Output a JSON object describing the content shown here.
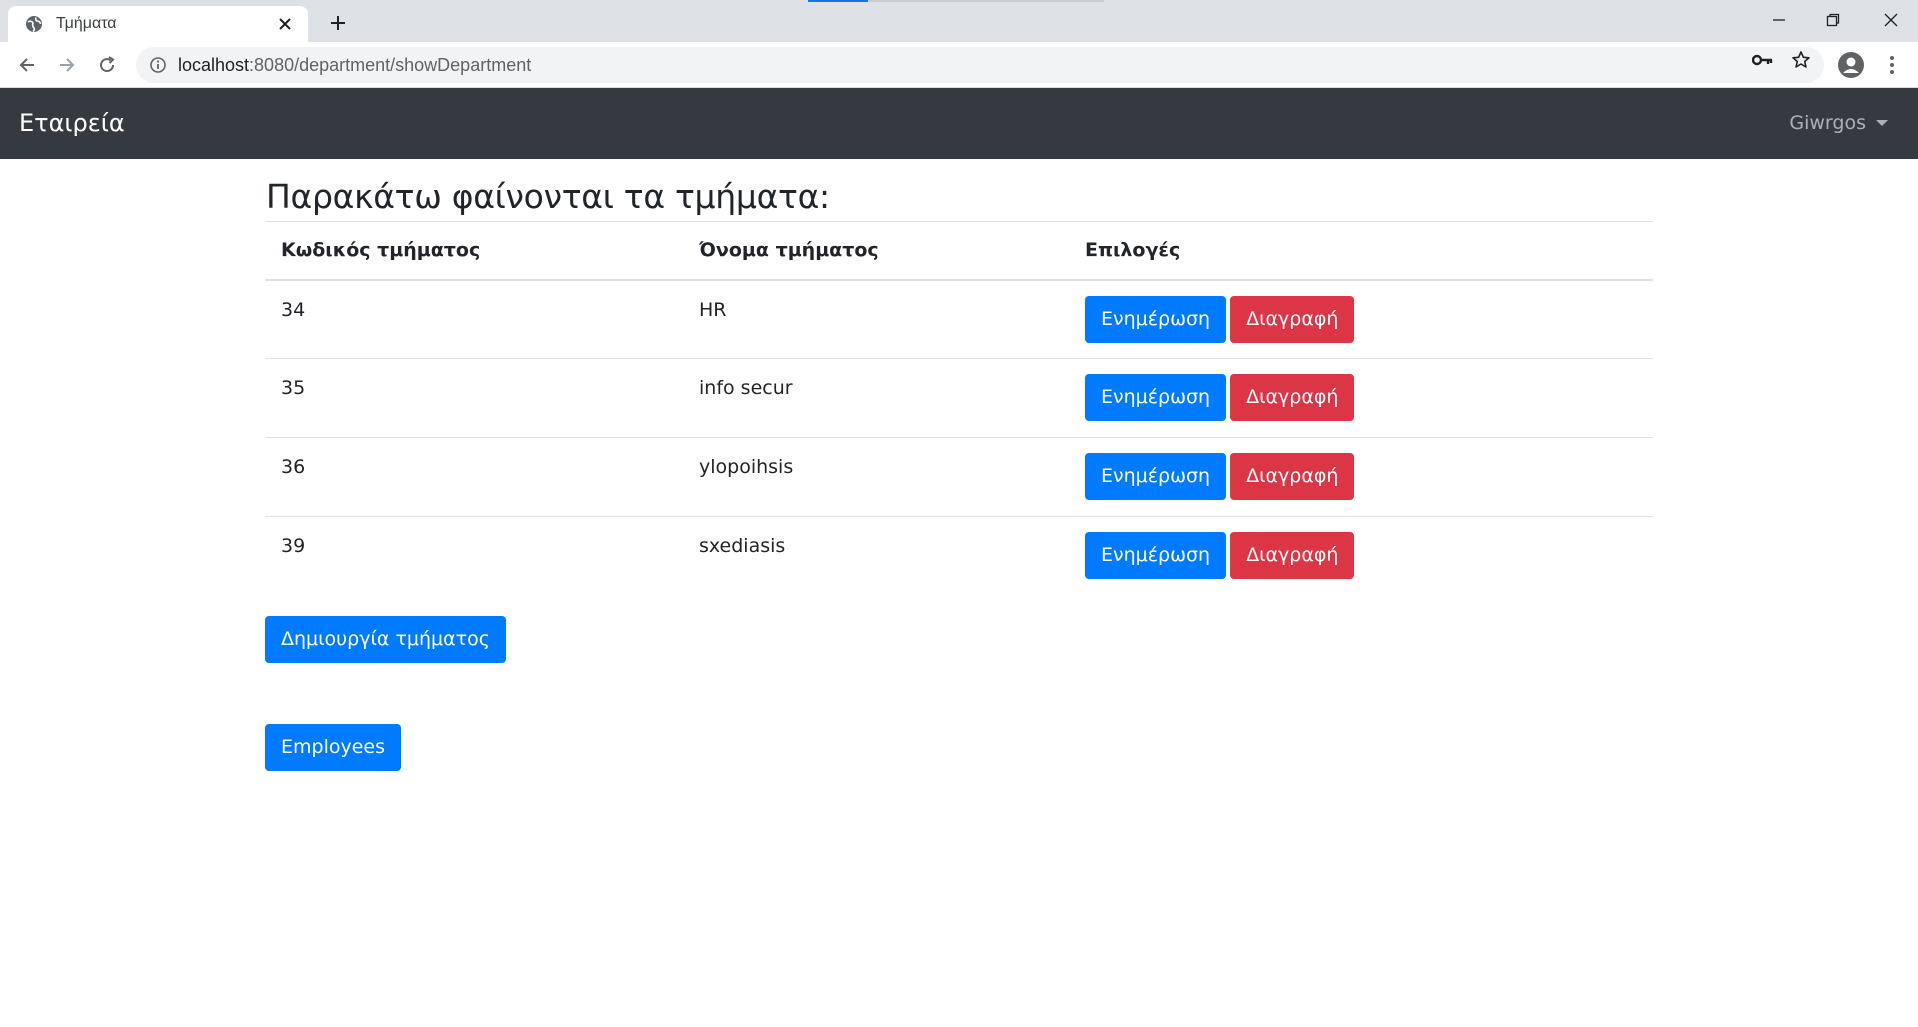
{
  "browser": {
    "tab_title": "Τμήματα",
    "url_host": "localhost",
    "url_port": ":8080",
    "url_path": "/department/showDepartment",
    "accent_color": "#1a73e8"
  },
  "navbar": {
    "brand": "Εταιρεία",
    "user": "Giwrgos",
    "background": "#343a40"
  },
  "main": {
    "title": "Παρακάτω φαίνονται τα τμήματα:",
    "table": {
      "headers": [
        "Κωδικός τμήματος",
        "Όνομα τμήματος",
        "Επιλογές"
      ],
      "rows": [
        {
          "id": "34",
          "name": "HR",
          "update_label": "Ενημέρωση",
          "delete_label": "Διαγραφή"
        },
        {
          "id": "35",
          "name": "info secur",
          "update_label": "Ενημέρωση",
          "delete_label": "Διαγραφή"
        },
        {
          "id": "36",
          "name": "ylopoihsis",
          "update_label": "Ενημέρωση",
          "delete_label": "Διαγραφή"
        },
        {
          "id": "39",
          "name": "sxediasis",
          "update_label": "Ενημέρωση",
          "delete_label": "Διαγραφή"
        }
      ]
    },
    "create_label": "Δημιουργία τμήματος",
    "employees_label": "Employees",
    "primary_color": "#007bff",
    "danger_color": "#dc3545"
  },
  "icons": {
    "favicon": "globe-icon",
    "tab_close": "close-icon",
    "new_tab": "plus-icon",
    "back": "arrow-left-icon",
    "forward": "arrow-right-icon",
    "reload": "reload-icon",
    "site_info": "info-icon",
    "password": "key-icon",
    "bookmark": "star-icon",
    "profile": "account-circle-icon",
    "menu": "more-vertical-icon"
  }
}
